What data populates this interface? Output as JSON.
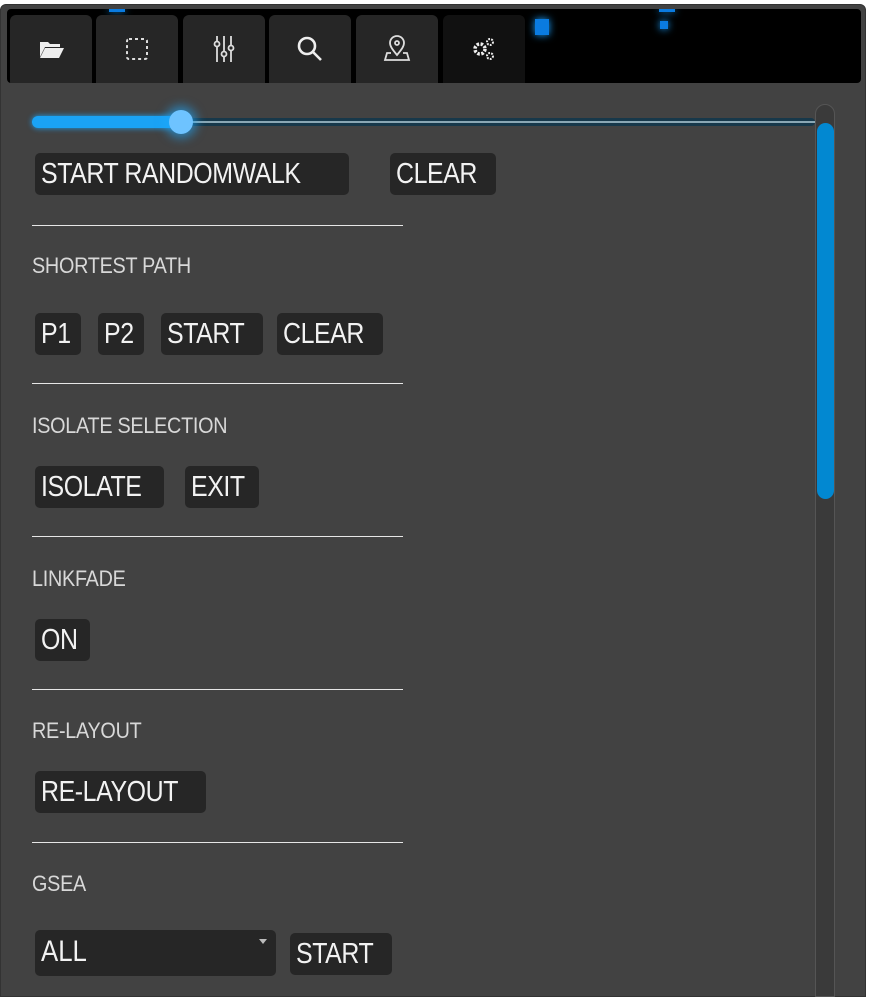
{
  "toolbar": {
    "tabs": [
      {
        "icon": "folder-open-icon",
        "active": false
      },
      {
        "icon": "selection-icon",
        "active": false
      },
      {
        "icon": "sliders-icon",
        "active": false
      },
      {
        "icon": "search-icon",
        "active": false
      },
      {
        "icon": "map-pin-icon",
        "active": false
      },
      {
        "icon": "gears-icon",
        "active": true
      }
    ]
  },
  "slider": {
    "value_percent": 19,
    "accent": "#1aa3f5"
  },
  "randomwalk": {
    "start": "START RANDOMWALK",
    "clear": "CLEAR"
  },
  "shortest_path": {
    "title": "SHORTEST PATH",
    "p1": "P1",
    "p2": "P2",
    "start": "START",
    "clear": "CLEAR"
  },
  "isolate": {
    "title": "ISOLATE SELECTION",
    "isolate": "ISOLATE",
    "exit": "EXIT"
  },
  "linkfade": {
    "title": "LINKFADE",
    "toggle": "ON"
  },
  "relayout": {
    "title": "RE-LAYOUT",
    "button": "RE-LAYOUT"
  },
  "gsea": {
    "title": "GSEA",
    "selected": "ALL",
    "start": "START"
  },
  "colors": {
    "panel": "#424242",
    "button": "#262626",
    "scroll_thumb": "#0288d1"
  }
}
